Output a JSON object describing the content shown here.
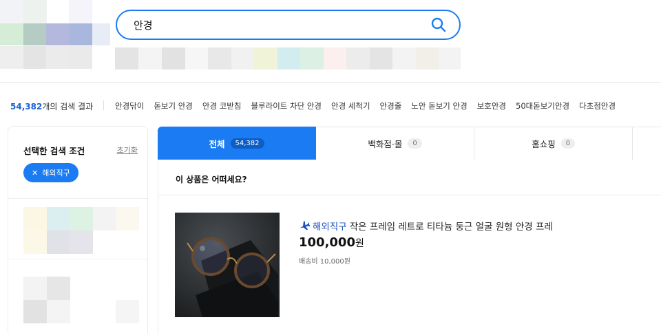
{
  "search": {
    "value": "안경",
    "placeholder": ""
  },
  "summary": {
    "count": "54,382",
    "suffix": "개의 검색 결과"
  },
  "related_keywords": [
    "안경닦이",
    "돋보기 안경",
    "안경 코받침",
    "블루라이트 차단 안경",
    "안경 세척기",
    "안경줄",
    "노안 돋보기 안경",
    "보호안경",
    "50대돋보기안경",
    "다초점안경"
  ],
  "filter_panel": {
    "title": "선택한 검색 조건",
    "reset_label": "초기화",
    "chip_label": "해외직구"
  },
  "tabs": [
    {
      "label": "전체",
      "count": "54,382"
    },
    {
      "label": "백화점·몰",
      "count": "0"
    },
    {
      "label": "홈쇼핑",
      "count": "0"
    }
  ],
  "section": {
    "title": "이 상품은 어떠세요?"
  },
  "product": {
    "tag": "해외직구",
    "title": "작은 프레임 레트로 티타늄 둥근 얼굴 원형 안경 프레",
    "price": "100,000",
    "price_unit": "원",
    "shipping": "배송비 10,000원"
  },
  "colors": {
    "accent": "#1a7bf2",
    "tag_blue": "#1a4fbf"
  }
}
